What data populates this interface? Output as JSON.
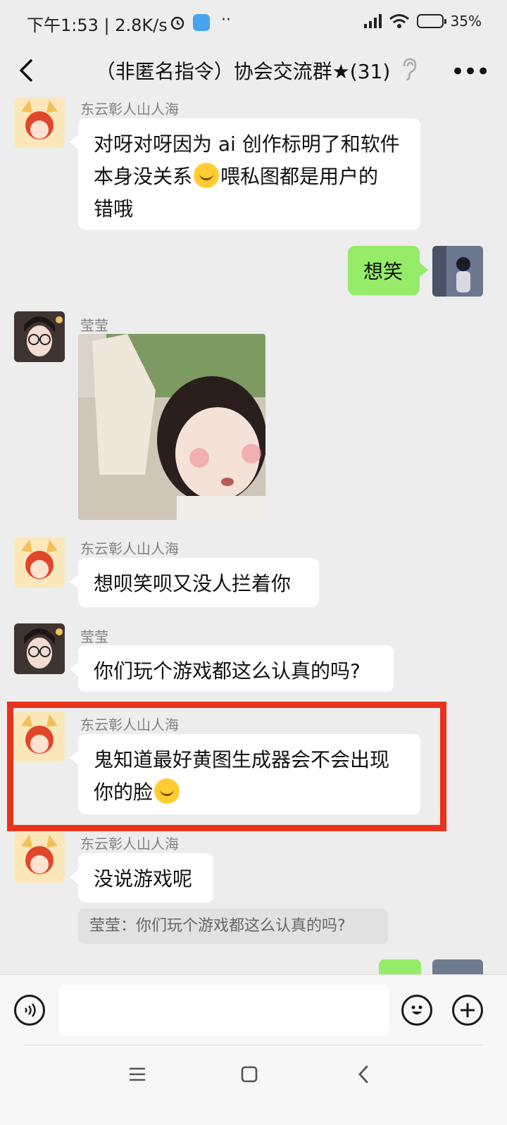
{
  "status_bar": {
    "time_speed": "下午1:53 | 2.8K/s",
    "battery": "35%"
  },
  "header": {
    "title": "（非匿名指令）协会交流群★(31)"
  },
  "messages": [
    {
      "sender": "东云彰人山人海",
      "text_1": "对呀对呀因为 ai 创作标明了和软件",
      "text_2a": "本身没关系",
      "text_2b": "喂私图都是用户的",
      "text_3": "错哦"
    },
    {
      "sender": "",
      "text": "想笑"
    },
    {
      "sender": "莹莹"
    },
    {
      "sender": "东云彰人山人海",
      "text": "想呗笑呗又没人拦着你"
    },
    {
      "sender": "莹莹",
      "text": "你们玩个游戏都这么认真的吗?"
    },
    {
      "sender": "东云彰人山人海",
      "text_1": "鬼知道最好黄图生成器会不会出现",
      "text_2": "你的脸"
    },
    {
      "sender": "东云彰人山人海",
      "text": "没说游戏呢",
      "quote": "莹莹：你们玩个游戏都这么认真的吗?"
    }
  ],
  "colors": {
    "highlight": "#e8321b",
    "own_bubble": "#95ec69",
    "background": "#ededed"
  }
}
